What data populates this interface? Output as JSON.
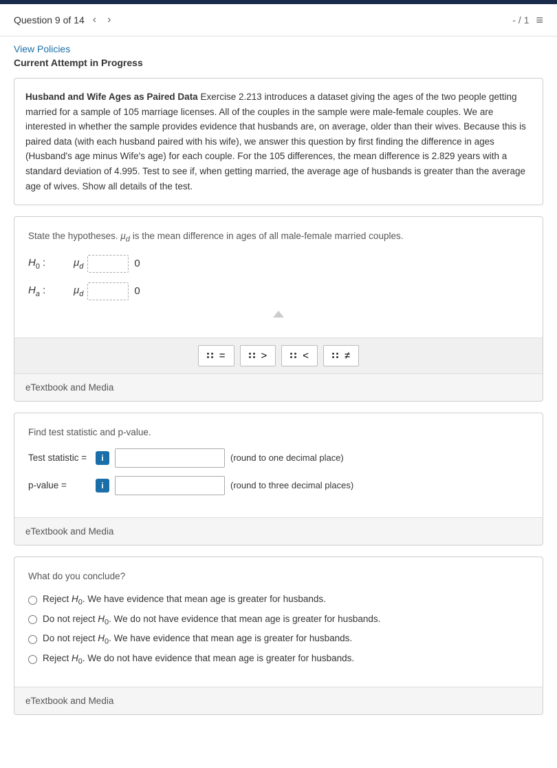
{
  "topbar": {},
  "header": {
    "question_counter": "Question 9 of 14",
    "score": "- / 1",
    "prev_label": "‹",
    "next_label": "›"
  },
  "links": {
    "view_policies": "View Policies"
  },
  "attempt": {
    "status": "Current Attempt in Progress"
  },
  "problem": {
    "title": "Husband and Wife Ages as Paired Data",
    "body": " Exercise 2.213 introduces a dataset giving the ages of the two people getting married for a sample of 105 marriage licenses. All of the couples in the sample were male-female couples. We are interested in whether the sample provides evidence that husbands are, on average, older than their wives. Because this is paired data (with each husband paired with his wife), we answer this question by first finding the difference in ages (Husband's age minus Wife's age) for each couple. For the 105 differences, the mean difference is 2.829 years with a standard deviation of 4.995. Test to see if, when getting married, the average age of husbands is greater than the average age of wives. Show all details of the test."
  },
  "section1": {
    "hypothesis_label": "State the hypotheses. μ",
    "hypothesis_label2": "d",
    "hypothesis_label3": " is the mean difference in ages of all male-female married couples.",
    "h0_label": "H",
    "h0_sub": "0",
    "h0_colon": ":",
    "h0_mu": "μ",
    "h0_mu_sub": "d",
    "h0_input": "",
    "h0_zero": "0",
    "ha_label": "H",
    "ha_sub": "a",
    "ha_colon": ":",
    "ha_mu": "μ",
    "ha_mu_sub": "d",
    "ha_input": "",
    "ha_zero": "0",
    "symbols": [
      "=",
      ">",
      "<",
      "≠"
    ],
    "etextbook": "eTextbook and Media"
  },
  "section2": {
    "label": "Find test statistic and p-value.",
    "test_statistic_label": "Test statistic =",
    "test_statistic_placeholder": "",
    "test_statistic_note": "(round to one decimal place)",
    "pvalue_label": "p-value =",
    "pvalue_placeholder": "",
    "pvalue_note": "(round to three decimal places)",
    "etextbook": "eTextbook and Media"
  },
  "section3": {
    "label": "What do you conclude?",
    "options": [
      "Reject H₀. We have evidence that mean age is greater for husbands.",
      "Do not reject H₀. We do not have evidence that mean age is greater for husbands.",
      "Do not reject H₀. We have evidence that mean age is greater for husbands.",
      "Reject H₀. We do not have evidence that mean age is greater for husbands."
    ],
    "etextbook": "eTextbook and Media"
  }
}
